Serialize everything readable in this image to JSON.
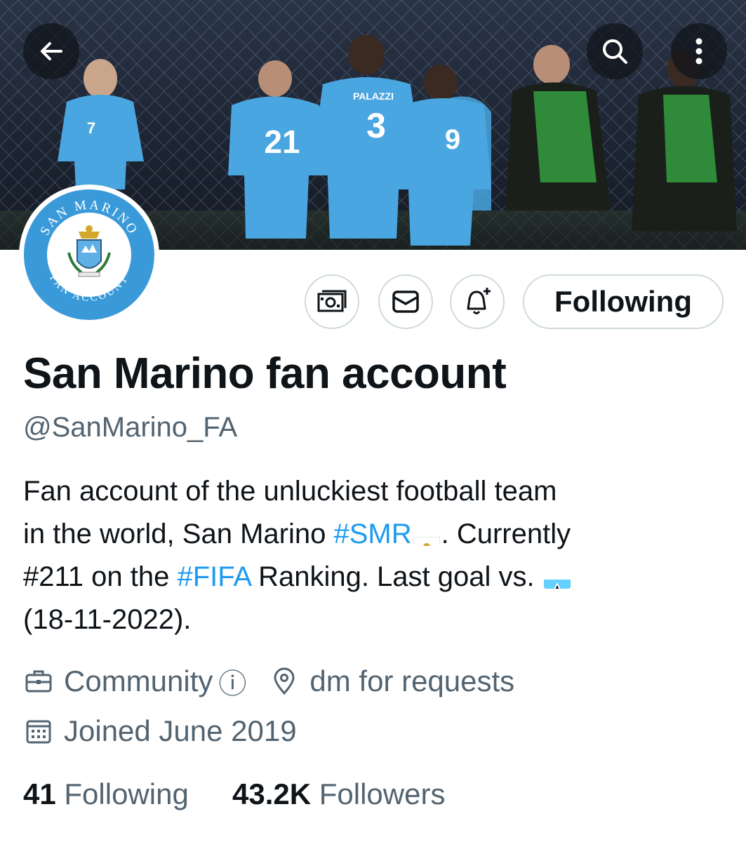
{
  "banner": {
    "jersey_numbers": [
      "7",
      "21",
      "3",
      "9"
    ],
    "jersey_name": "PALAZZI"
  },
  "avatar": {
    "text_top": "SAN MARINO",
    "text_bottom": "FAN ACCOUNT"
  },
  "topbar": {
    "back_icon": "back-arrow-icon",
    "search_icon": "search-icon",
    "more_icon": "more-vertical-icon"
  },
  "actions": {
    "subscribe_icon": "money-icon",
    "message_icon": "envelope-icon",
    "notify_icon": "bell-plus-icon",
    "following_label": "Following"
  },
  "profile": {
    "display_name": "San Marino fan account",
    "handle": "@SanMarino_FA",
    "bio": {
      "l1": "Fan account of the unluckiest football team",
      "l2_a": "in the world, San Marino ",
      "l2_tag": "#SMR",
      "l2_b": ". Currently",
      "l3_a": "#211 on the ",
      "l3_tag": "#FIFA",
      "l3_b": " Ranking. Last goal vs. ",
      "l4": "(18-11-2022)."
    },
    "category": "Community",
    "category_info": "ⓘ",
    "location": "dm for requests",
    "joined": "Joined June 2019",
    "following_count": "41",
    "following_label": "Following",
    "followers_count": "43.2K",
    "followers_label": "Followers"
  },
  "colors": {
    "link": "#1d9bf0",
    "secondary": "#536471",
    "kit_blue": "#4aa6e0"
  }
}
